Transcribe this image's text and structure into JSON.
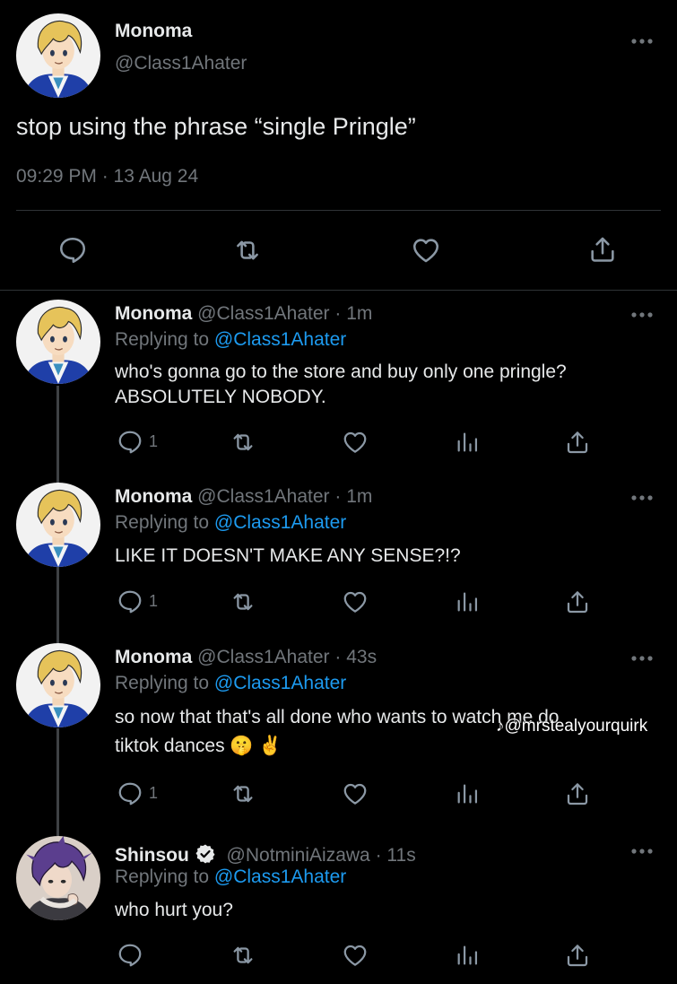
{
  "main_tweet": {
    "name": "Monoma",
    "handle": "@Class1Ahater",
    "text": "stop using the phrase “single Pringle”",
    "timestamp": "09:29 PM · 13 Aug 24"
  },
  "replies": [
    {
      "name": "Monoma",
      "meta": "@Class1Ahater · 1m",
      "replying_prefix": "Replying to",
      "replying_to": "@Class1Ahater",
      "text_lines": [
        "who's gonna go to the store and buy only one pringle?",
        "ABSOLUTELY NOBODY."
      ],
      "reply_count": "1"
    },
    {
      "name": "Monoma",
      "meta": "@Class1Ahater · 1m",
      "replying_prefix": "Replying to",
      "replying_to": "@Class1Ahater",
      "text_lines": [
        "LIKE IT DOESN'T MAKE ANY SENSE?!?"
      ],
      "reply_count": "1"
    },
    {
      "name": "Monoma",
      "meta": "@Class1Ahater · 43s",
      "replying_prefix": "Replying to",
      "replying_to": "@Class1Ahater",
      "text_lines": [
        "so now that that's all done who wants to watch me do",
        "tiktok dances 🤫 ✌️"
      ],
      "reply_count": "1"
    },
    {
      "name": "Shinsou",
      "meta": "@NotminiAizawa · 11s",
      "replying_prefix": "Replying to",
      "replying_to": "@Class1Ahater",
      "text_lines": [
        "who hurt you?"
      ],
      "reply_count": ""
    }
  ],
  "watermark": "@mrstealyourquirk",
  "colors": {
    "background": "#000000",
    "text": "#e7e9ea",
    "secondary": "#71767b",
    "link": "#1d9bf0",
    "divider": "#2f3336"
  },
  "icons": [
    "reply-icon",
    "retweet-icon",
    "like-icon",
    "share-icon",
    "views-icon",
    "more-icon",
    "verified-icon",
    "tiktok-icon"
  ]
}
